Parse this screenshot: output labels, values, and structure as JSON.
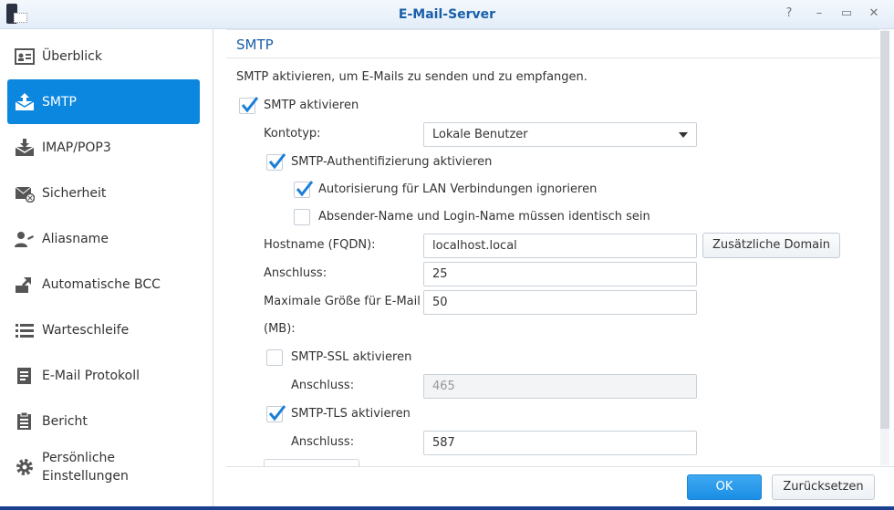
{
  "window": {
    "title": "E-Mail-Server",
    "help": "?",
    "minimize": "–",
    "maximize": "▭",
    "close": "✕"
  },
  "sidebar": {
    "items": [
      {
        "label": "Überblick",
        "icon": "overview-icon"
      },
      {
        "label": "SMTP",
        "icon": "mail-send-icon",
        "active": true
      },
      {
        "label": "IMAP/POP3",
        "icon": "mail-receive-icon"
      },
      {
        "label": "Sicherheit",
        "icon": "mail-security-icon"
      },
      {
        "label": "Aliasname",
        "icon": "alias-icon"
      },
      {
        "label": "Automatische BCC",
        "icon": "bcc-icon"
      },
      {
        "label": "Warteschleife",
        "icon": "queue-icon"
      },
      {
        "label": "E-Mail Protokoll",
        "icon": "log-icon"
      },
      {
        "label": "Bericht",
        "icon": "report-icon"
      },
      {
        "label": "Persönliche Einstellungen",
        "icon": "gear-icon"
      }
    ]
  },
  "main": {
    "section_title": "SMTP",
    "description": "SMTP aktivieren, um E-Mails zu senden und zu empfangen.",
    "enable_smtp": {
      "label": "SMTP aktivieren",
      "checked": true
    },
    "account_type": {
      "label": "Kontotyp:",
      "value": "Lokale Benutzer"
    },
    "smtp_auth": {
      "label": "SMTP-Authentifizierung aktivieren",
      "checked": true
    },
    "ignore_lan": {
      "label": "Autorisierung für LAN Verbindungen ignorieren",
      "checked": true
    },
    "sender_match": {
      "label": "Absender-Name und Login-Name müssen identisch sein",
      "checked": false
    },
    "hostname": {
      "label": "Hostname (FQDN):",
      "value": "localhost.local",
      "button": "Zusätzliche Domain"
    },
    "port": {
      "label": "Anschluss:",
      "value": "25"
    },
    "max_size": {
      "label": "Maximale Größe für E-Mail",
      "label2": "(MB):",
      "value": "50"
    },
    "ssl": {
      "label": "SMTP-SSL aktivieren",
      "checked": false,
      "port_label": "Anschluss:",
      "port": "465"
    },
    "tls": {
      "label": "SMTP-TLS aktivieren",
      "checked": true,
      "port_label": "Anschluss:",
      "port": "587"
    }
  },
  "footer": {
    "ok": "OK",
    "reset": "Zurücksetzen"
  },
  "colors": {
    "accent": "#0b87e0",
    "title": "#1a5fa8"
  }
}
